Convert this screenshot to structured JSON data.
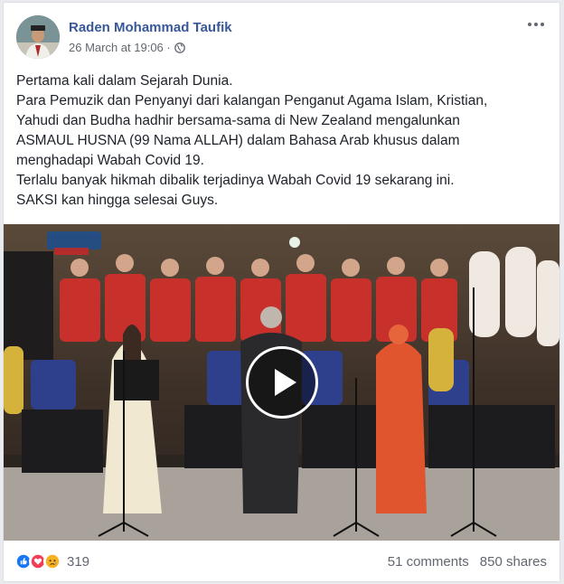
{
  "post": {
    "author": "Raden Mohammad Taufik",
    "timestamp": "26 March at 19:06 ·",
    "privacy_icon": "globe-icon",
    "more_icon": "more-options-icon",
    "text_lines": [
      "Pertama kali dalam Sejarah Dunia.",
      "Para Pemuzik dan Penyanyi dari kalangan Penganut Agama Islam, Kristian,",
      "Yahudi dan Budha hadhir bersama-sama di New Zealand mengalunkan",
      "ASMAUL HUSNA (99 Nama ALLAH) dalam Bahasa Arab khusus dalam",
      "menghadapi Wabah Covid 19.",
      "Terlalu banyak hikmah dibalik terjadinya Wabah Covid 19 sekarang ini.",
      "SAKSI kan hingga selesai Guys."
    ],
    "video": {
      "play_icon": "play-icon"
    },
    "reactions": {
      "icons": [
        "like-icon",
        "love-icon",
        "sad-icon"
      ],
      "count": "319"
    },
    "comments": "51 comments",
    "shares": "850 shares"
  },
  "colors": {
    "author_link": "#385898",
    "like": "#1877f2",
    "love": "#f33e58",
    "sad": "#f7b125"
  }
}
